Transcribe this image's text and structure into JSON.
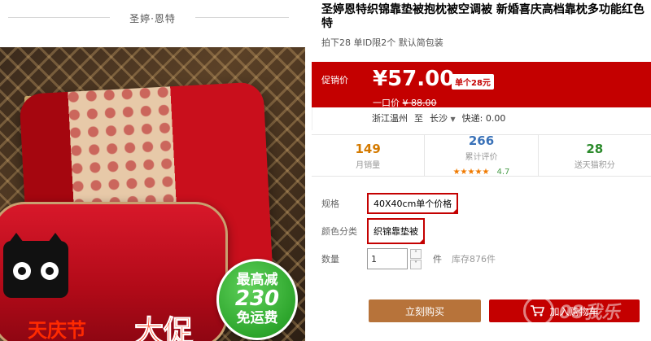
{
  "brand": {
    "name": "圣婷·恩特"
  },
  "image": {
    "promo": {
      "line1": "最高减",
      "line2": "230",
      "line3": "免运费"
    },
    "banner_left": "天庆节",
    "banner_big": "大促"
  },
  "product": {
    "title": "圣婷恩特织锦靠垫被抱枕被空调被   新婚喜庆高档靠枕多功能红色特",
    "subtitle": "拍下28 单ID限2个 默认简包装"
  },
  "price": {
    "label": "促销价",
    "current": "¥57.00",
    "tag": "单个28元",
    "orig_label": "一口价",
    "orig_value": "¥ 88.00"
  },
  "shipping": {
    "from": "浙江温州",
    "to_word": "至",
    "to": "长沙",
    "express": "快递: 0.00"
  },
  "stats": [
    {
      "value": "149",
      "label": "月销量"
    },
    {
      "value": "266",
      "label": "累计评价",
      "stars": "★★★★★",
      "score": "4.7"
    },
    {
      "value": "28",
      "label": "送天猫积分"
    }
  ],
  "options": {
    "spec_label": "规格",
    "spec_value": "40X40cm单个价格",
    "color_label": "颜色分类",
    "color_value": "织锦靠垫被",
    "qty_label": "数量",
    "qty_value": "1",
    "qty_up": "˄",
    "qty_down": "˅",
    "unit": "件",
    "stock": "库存876件"
  },
  "actions": {
    "buy_now": "立刻购买",
    "add_cart": "加入购物车"
  },
  "watermark": "08我乐",
  "colors": {
    "accent": "#c40000",
    "buy": "#b7733a",
    "promo_badge": "#2ea62d"
  }
}
